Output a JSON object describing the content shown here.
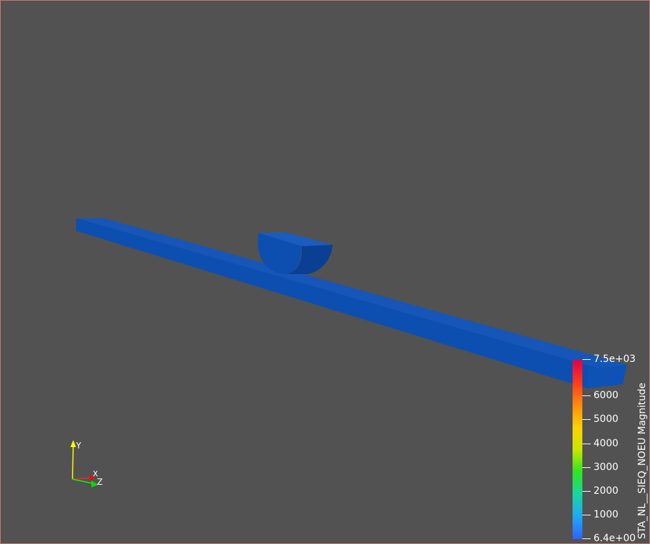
{
  "scene": {
    "background": "#525252",
    "beam_color": "#0d4fb0",
    "block_color": "#0c47a4"
  },
  "axes": {
    "y_label": "Y",
    "x_label": "X",
    "z_label": "Z",
    "y_color": "#ffff00",
    "x_color": "#ff0000",
    "z_color": "#00ff00"
  },
  "legend": {
    "title": "STA_NL__SIEQ_NOEU Magnitude",
    "max_label": "7.5e+03",
    "min_label": "6.4e+00",
    "ticks": [
      "6000",
      "5000",
      "4000",
      "3000",
      "2000",
      "1000"
    ],
    "range": [
      6.4,
      7500
    ],
    "colormap": [
      "#2e63ff",
      "#1fa8f5",
      "#18d6a0",
      "#2ee620",
      "#c8e600",
      "#ffd000",
      "#ff8a10",
      "#ff3a1a",
      "#e0004a"
    ]
  }
}
